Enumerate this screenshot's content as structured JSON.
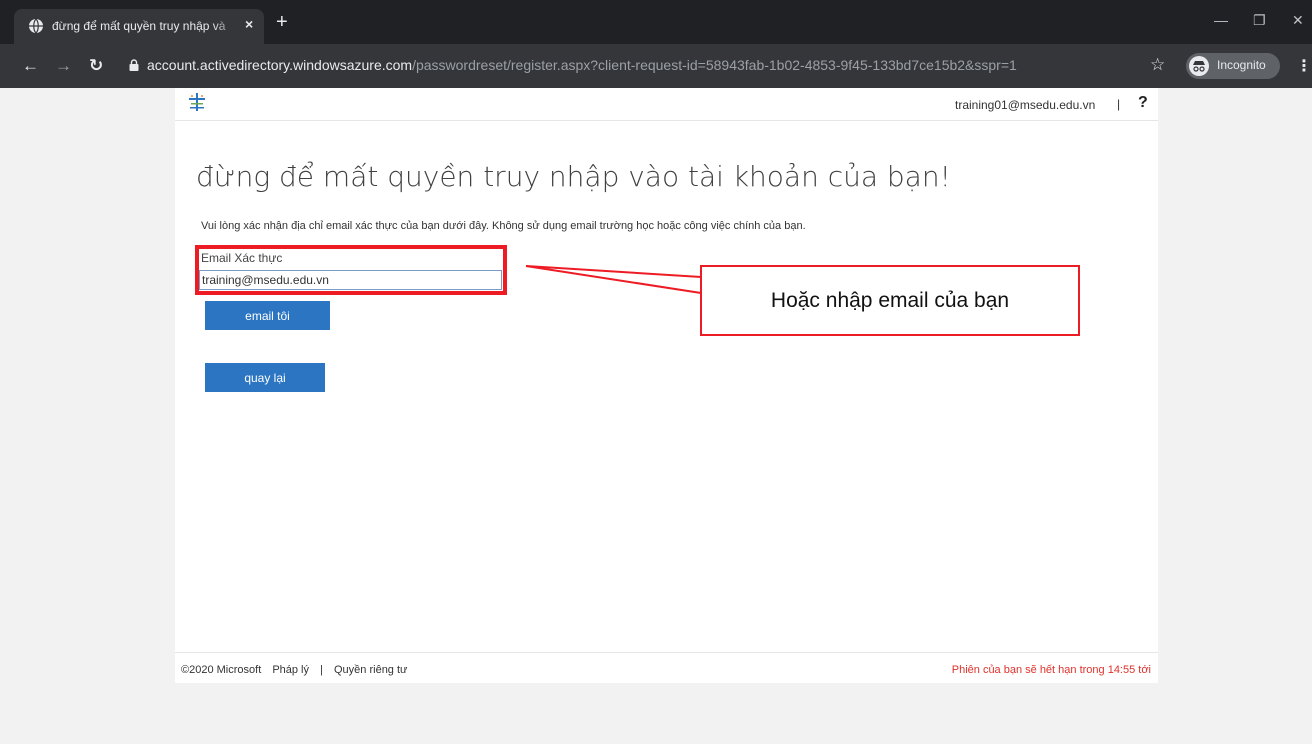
{
  "browser": {
    "tab_title": "đừng để mất quyền truy nhập và",
    "tab_close": "×",
    "new_tab": "+",
    "window_controls": [
      "—",
      "❐",
      "✕"
    ],
    "url_host": "account.activedirectory.windowsazure.com",
    "url_path": "/passwordreset/register.aspx?client-request-id=58943fab-1b02-4853-9f45-133bd7ce15b2&sspr=1",
    "incognito_label": "Incognito",
    "icons": [
      "globe-icon",
      "back-icon",
      "forward-icon",
      "reload-icon",
      "lock-icon",
      "star-icon",
      "incognito-icon",
      "kebab-menu-icon"
    ]
  },
  "header": {
    "user": "training01@msedu.edu.vn",
    "separator": "|",
    "help": "?"
  },
  "main": {
    "title": "đừng để mất quyền truy nhập vào tài khoản của bạn!",
    "description": "Vui lòng xác nhận địa chỉ email xác thực của bạn dưới đây. Không sử dụng email trường học hoặc công việc chính của bạn.",
    "field_label": "Email Xác thực",
    "email_value": "training@msedu.edu.vn",
    "email_button": "email tôi",
    "back_button": "quay lại"
  },
  "footer": {
    "copyright": "©2020 Microsoft",
    "legal": "Pháp lý",
    "divider": "|",
    "privacy": "Quyền riêng tư",
    "session_notice": "Phiên của bạn sẽ hết hạn trong 14:55 tới"
  },
  "annotation": {
    "callout_text": "Hoặc nhập email của bạn",
    "color": "#ed1c24"
  }
}
